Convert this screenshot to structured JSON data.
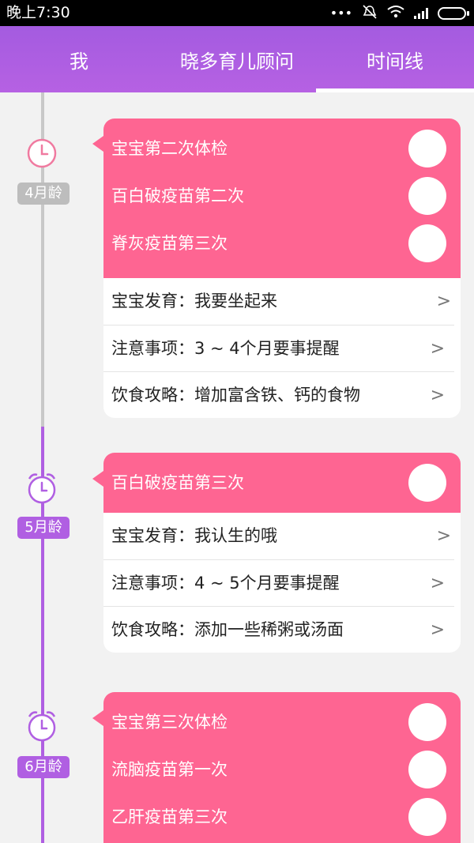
{
  "status_bar": {
    "time": "晚上7:30",
    "icons": [
      "more-icon",
      "mute-icon",
      "wifi-icon",
      "signal-icon",
      "battery-icon"
    ]
  },
  "tabs": [
    {
      "label": "我"
    },
    {
      "label": "晓多育儿顾问"
    },
    {
      "label": "时间线",
      "active": true
    }
  ],
  "colors": {
    "accent_purple": "#b05fe2",
    "card_pink": "#fe6592",
    "past_gray": "#bdbdbd",
    "clock_pink": "#f07aa0"
  },
  "timeline": [
    {
      "age": "4月龄",
      "vaccines": [
        "宝宝第二次体检",
        "百白破疫苗第二次",
        "脊灰疫苗第三次"
      ],
      "info": [
        "宝宝发育：我要坐起来",
        "注意事项：3 ~ 4个月要事提醒",
        "饮食攻略：增加富含铁、钙的食物"
      ]
    },
    {
      "age": "5月龄",
      "vaccines": [
        "百白破疫苗第三次"
      ],
      "info": [
        "宝宝发育：我认生的哦",
        "注意事项：4 ~ 5个月要事提醒",
        "饮食攻略：添加一些稀粥或汤面"
      ]
    },
    {
      "age": "6月龄",
      "vaccines": [
        "宝宝第三次体检",
        "流脑疫苗第一次",
        "乙肝疫苗第三次"
      ],
      "info": []
    }
  ]
}
